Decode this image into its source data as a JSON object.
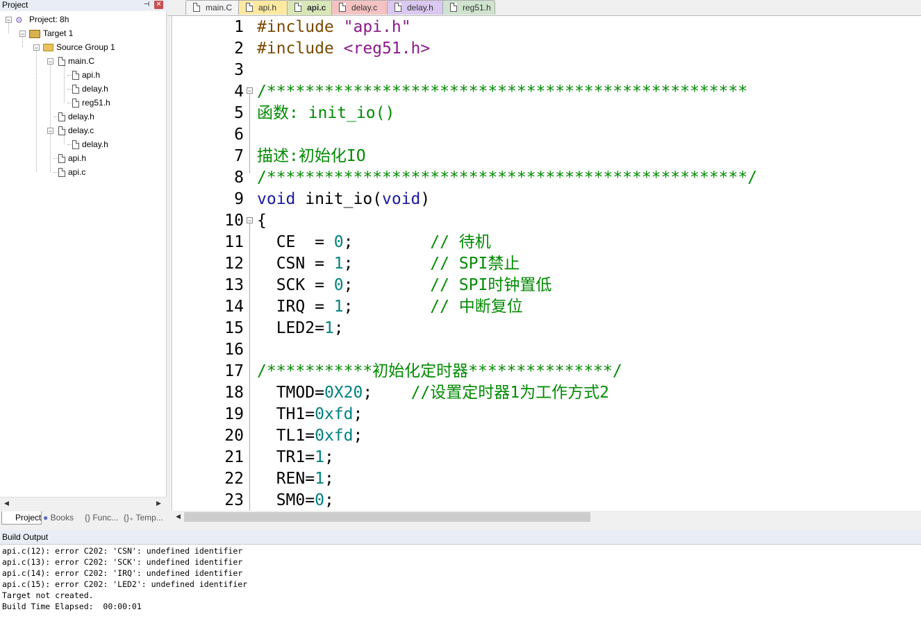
{
  "project_panel": {
    "title": "Project",
    "pin_glyph": "⊣",
    "close_glyph": "✕",
    "tree": {
      "project": "Project: 8h",
      "target": "Target 1",
      "group": "Source Group 1",
      "main_c": "main.C",
      "main_children": [
        "api.h",
        "delay.h",
        "reg51.h"
      ],
      "delay_h": "delay.h",
      "delay_c": "delay.c",
      "delay_c_children": [
        "delay.h"
      ],
      "api_h": "api.h",
      "api_c": "api.c"
    },
    "tabs": [
      "Project",
      "Books",
      "{} Func...",
      "{}₊ Temp..."
    ]
  },
  "editor_tabs": [
    {
      "label": "main.C",
      "color": "#f0f0f0"
    },
    {
      "label": "api.h",
      "color": "#fde9a0"
    },
    {
      "label": "api.c",
      "color": "#d8e6b8"
    },
    {
      "label": "delay.c",
      "color": "#f4c2c2"
    },
    {
      "label": "delay.h",
      "color": "#d9c8f0"
    },
    {
      "label": "reg51.h",
      "color": "#cfe3cf"
    }
  ],
  "code": {
    "line_numbers": [
      "1",
      "2",
      "3",
      "4",
      "5",
      "6",
      "7",
      "8",
      "9",
      "10",
      "11",
      "12",
      "13",
      "14",
      "15",
      "16",
      "17",
      "18",
      "19",
      "20",
      "21",
      "22",
      "23"
    ]
  },
  "build_output": {
    "title": "Build Output",
    "lines": [
      "api.c(12): error C202: 'CSN': undefined identifier",
      "api.c(13): error C202: 'SCK': undefined identifier",
      "api.c(14): error C202: 'IRQ': undefined identifier",
      "api.c(15): error C202: 'LED2': undefined identifier",
      "Target not created.",
      "Build Time Elapsed:  00:00:01"
    ]
  }
}
